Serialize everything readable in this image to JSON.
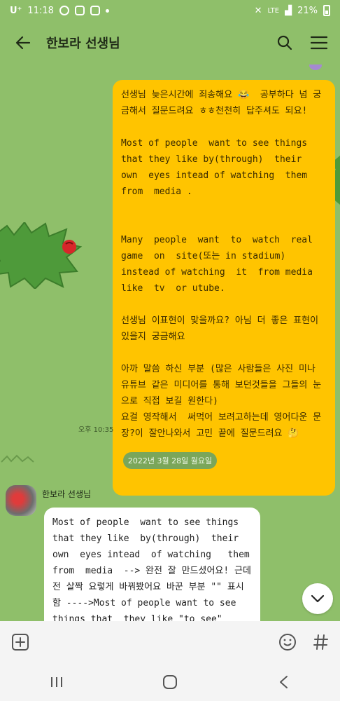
{
  "status_bar": {
    "carrier": "U⁺",
    "time": "11:18",
    "network": "LTE",
    "battery": "21%"
  },
  "header": {
    "title": "한보라 선생님",
    "back_icon": "arrow-left-icon",
    "search_icon": "search-icon",
    "menu_icon": "menu-icon"
  },
  "messages": {
    "outgoing": {
      "text": "선생님 늦은시간에 죄송해요 😂  공부하다 넘 궁금해서 질문드려요 ㅎㅎ천천히 답주셔도 되요!\n\nMost of people  want to see things that they like by(through)  their  own  eyes intead of watching  them  from  media .\n\n\nMany  people  want  to  watch  real game  on  site(또는 in stadium) instead of watching  it  from media  like  tv  or utube.\n\n선생님 이표현이 맞을까요? 아님 더 좋은 표현이 있을지 궁금해요\n\n아까 말씀 하신 부분 (많은 사람들은 사진 미나 유튜브 같은 미디어를 통해 보던것들을 그들의 눈으로 직접 보길 원한다)\n요걸 영작해서  써먹어 보려고하는데 영어다운 문장?이 잘안나와서 고민 끝에 질문드려요 🤔",
      "time": "오후 10:35"
    },
    "date_divider": "2022년 3월 28일 월요일",
    "incoming": {
      "sender": "한보라 선생님",
      "text": "Most of people  want to see things that they like  by(through)  their  own  eyes intead  of watching   them  from  media  --> 완전 잘 만드셨어요! 근데 전 살짝 요렇게 바꿔봤어요 바꾼 부분 \"\" 표시함 ---->Most of people want to see things that  they like \"to see\" \"with\" their own eyes \"rather"
    }
  },
  "input_bar": {
    "placeholder": "",
    "add_icon": "plus-square-icon",
    "emoji_icon": "emoji-icon",
    "hash_icon": "hash-icon"
  },
  "nav_bar": {
    "recent_icon": "recent-apps-icon",
    "home_icon": "home-icon",
    "back_icon": "nav-back-icon"
  },
  "colors": {
    "background": "#8fbf6a",
    "outgoing_bubble": "#ffc400",
    "incoming_bubble": "#ffffff"
  }
}
